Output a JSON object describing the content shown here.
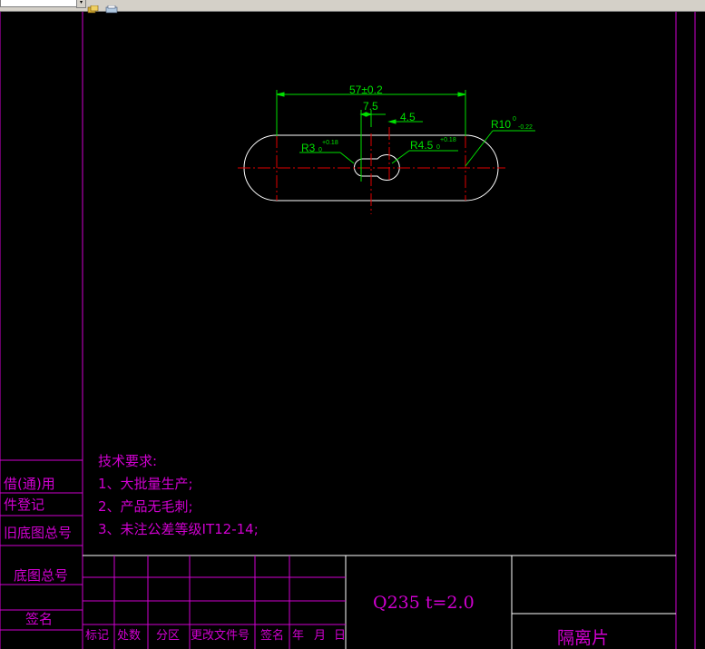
{
  "app": {
    "toolbar": {
      "combo_value": "",
      "icons": [
        "layer-manager-icon",
        "print-icon"
      ]
    }
  },
  "drawing": {
    "colors": {
      "frame": "#d000d0",
      "dimension": "#00e000",
      "center_line": "#e00000",
      "geometry": "#ffffff"
    },
    "dimensions": {
      "overall_length": "57±0.2",
      "hole_spacing": "7.5",
      "offset": "4.5",
      "end_radius_base": "R10",
      "end_radius_upper": "0",
      "end_radius_lower": "-0.22",
      "small_hole_base": "R3",
      "small_hole_lower": "0",
      "small_hole_upper": "+0.18",
      "large_hole_base": "R4.5",
      "large_hole_lower": "0",
      "large_hole_upper": "+0.18"
    },
    "notes": {
      "title": "技术要求:",
      "items": [
        "1、大批量生产;",
        "2、产品无毛刺;",
        "3、未注公差等级IT12-14;"
      ]
    },
    "side_column": {
      "borrow_use": "借(通)用",
      "registration": "件登记",
      "old_base_number": "旧底图总号",
      "base_number": "底图总号",
      "signature": "签名"
    },
    "title_block": {
      "material": "Q235  t=2.0",
      "part_name": "隔离片",
      "revision_headers": [
        "标记",
        "处数",
        "分区",
        "更改文件号",
        "签名",
        "年",
        "月",
        "日"
      ]
    }
  }
}
